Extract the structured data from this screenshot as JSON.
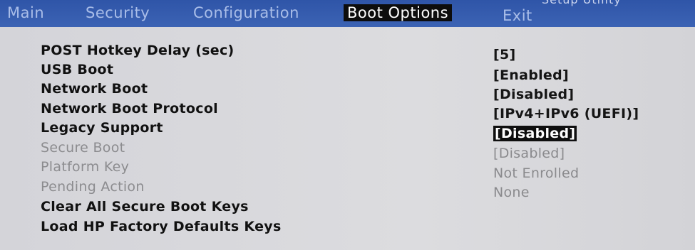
{
  "header": {
    "title_partial": "Setup Utility"
  },
  "tabs": [
    {
      "label": "Main"
    },
    {
      "label": "Security"
    },
    {
      "label": "Configuration"
    },
    {
      "label": "Boot Options"
    },
    {
      "label": "Exit"
    }
  ],
  "active_tab": "Boot Options",
  "settings": [
    {
      "label": "POST Hotkey Delay (sec)",
      "value": "[5]"
    },
    {
      "label": "USB Boot",
      "value": "[Enabled]"
    },
    {
      "label": "Network Boot",
      "value": "[Disabled]"
    },
    {
      "label": "Network Boot Protocol",
      "value": "[IPv4+IPv6 (UEFI)]"
    },
    {
      "label": "Legacy Support",
      "value": "[Disabled]"
    },
    {
      "label": "Secure Boot",
      "value": "[Disabled]"
    },
    {
      "label": "Platform Key",
      "value": "Not Enrolled"
    },
    {
      "label": "Pending Action",
      "value": "None"
    },
    {
      "label": "Clear All Secure Boot Keys",
      "value": ""
    },
    {
      "label": "Load HP Factory Defaults Keys",
      "value": ""
    }
  ],
  "colors": {
    "header_bg": "#2f55a8",
    "panel_bg": "#d9d9dd",
    "selected_bg": "#0f0f0f",
    "disabled_text": "#8c8c8f"
  }
}
